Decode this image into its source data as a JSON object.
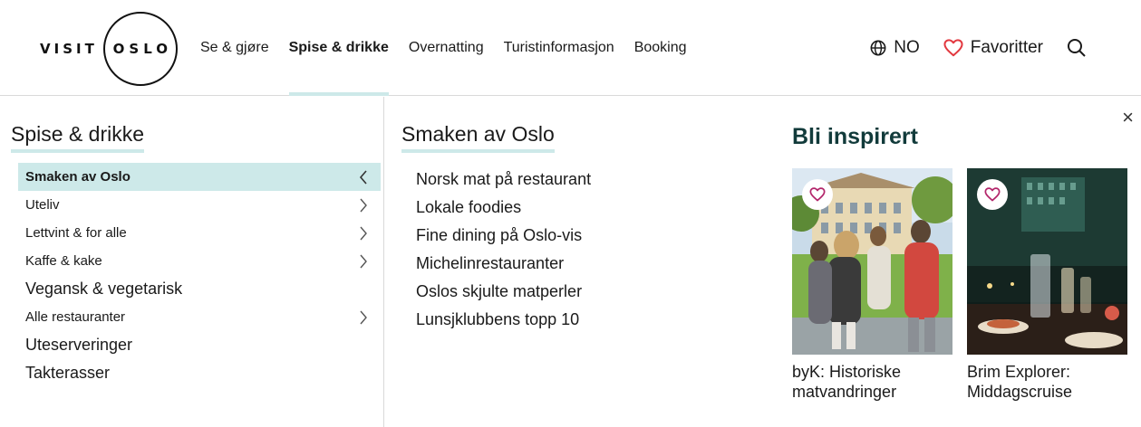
{
  "header": {
    "logo": {
      "visit": "VISIT",
      "oslo": "OSLO"
    },
    "nav": [
      {
        "label": "Se & gjøre"
      },
      {
        "label": "Spise & drikke",
        "active": true
      },
      {
        "label": "Overnatting"
      },
      {
        "label": "Turistinformasjon"
      },
      {
        "label": "Booking"
      }
    ],
    "language": "NO",
    "favorites": "Favoritter",
    "icons": {
      "language": "globe-icon",
      "favorites": "heart-icon",
      "search": "search-icon"
    },
    "accent_color": "#e2383f"
  },
  "left": {
    "title": "Spise & drikke",
    "menu": [
      {
        "label": "Smaken av Oslo",
        "active": true,
        "chevron": "chevron-left-icon"
      },
      {
        "label": "Uteliv",
        "chevron": "chevron-right-icon"
      },
      {
        "label": "Lettvint & for alle",
        "chevron": "chevron-right-icon"
      },
      {
        "label": "Kaffe & kake",
        "chevron": "chevron-right-icon"
      },
      {
        "label": "Vegansk & vegetarisk"
      },
      {
        "label": "Alle restauranter",
        "chevron": "chevron-right-icon"
      },
      {
        "label": "Uteserveringer"
      },
      {
        "label": "Takterasser"
      }
    ]
  },
  "middle": {
    "title": "Smaken av Oslo",
    "links": [
      "Norsk mat på restaurant",
      "Lokale foodies",
      "Fine dining på Oslo-vis",
      "Michelinrestauranter",
      "Oslos skjulte matperler",
      "Lunsjklubbens topp 10"
    ]
  },
  "right": {
    "title": "Bli inspirert",
    "close": "×",
    "cards": [
      {
        "title_line1": "byK: Historiske",
        "title_line2": "matvandringer"
      },
      {
        "title_line1": "Brim Explorer:",
        "title_line2": "Middagscruise"
      }
    ]
  },
  "colors": {
    "highlight": "#cde9e9",
    "heading": "#123b3b",
    "heart": "#e2383f"
  }
}
